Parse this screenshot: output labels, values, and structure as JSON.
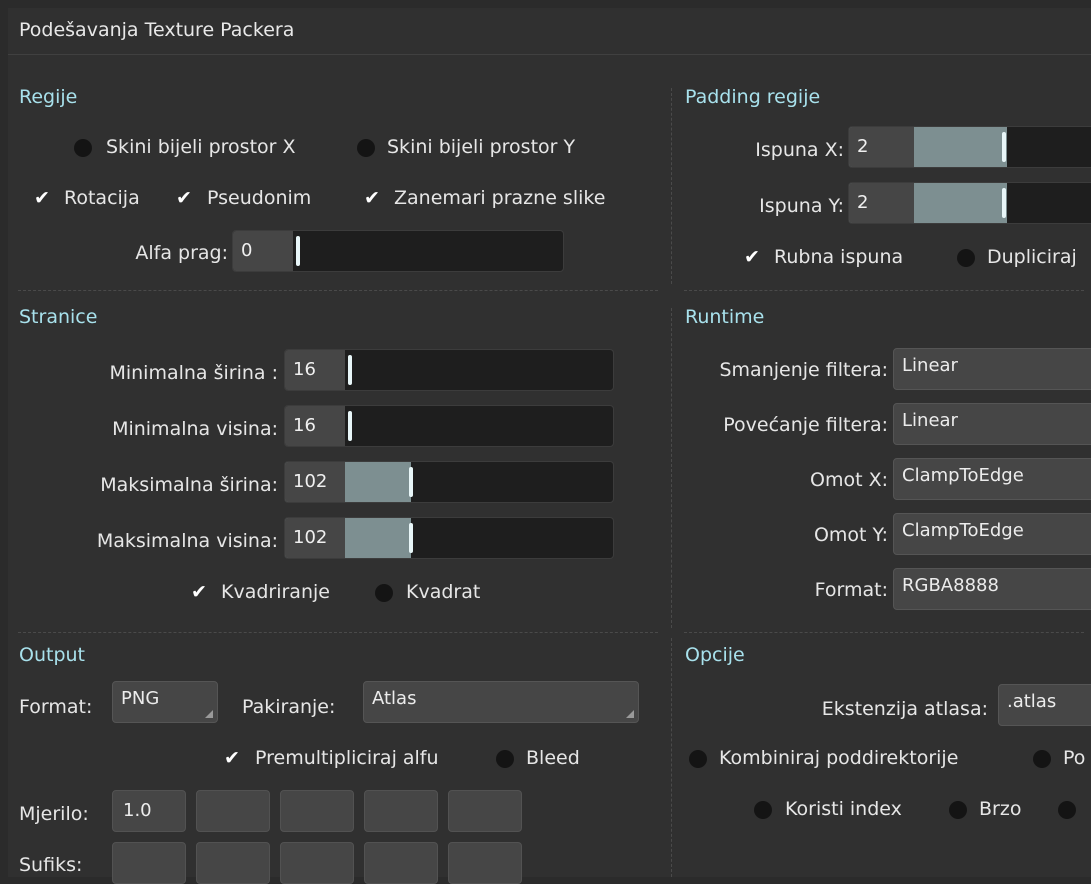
{
  "title": "Podešavanja Texture Packera",
  "regions": {
    "heading": "Regije",
    "strip_x": "Skini bijeli prostor X",
    "strip_y": "Skini bijeli prostor Y",
    "rotation": "Rotacija",
    "alias": "Pseudonim",
    "ignore_blank": "Zanemari prazne slike",
    "alpha_label": "Alfa prag:",
    "alpha_value": "0"
  },
  "padding": {
    "heading": "Padding regije",
    "pad_x_label": "Ispuna X:",
    "pad_x_value": "2",
    "pad_y_label": "Ispuna Y:",
    "pad_y_value": "2",
    "edge": "Rubna ispuna",
    "duplicate": "Dupliciraj"
  },
  "pages": {
    "heading": "Stranice",
    "min_w_label": "Minimalna širina :",
    "min_w_value": "16",
    "min_h_label": "Minimalna visina:",
    "min_h_value": "16",
    "max_w_label": "Maksimalna širina:",
    "max_w_value": "102",
    "max_h_label": "Maksimalna visina:",
    "max_h_value": "102",
    "pot": "Kvadriranje",
    "square": "Kvadrat"
  },
  "runtime": {
    "heading": "Runtime",
    "min_filter_label": "Smanjenje filtera:",
    "min_filter_value": "Linear",
    "mag_filter_label": "Povećanje filtera:",
    "mag_filter_value": "Linear",
    "wrap_x_label": "Omot X:",
    "wrap_x_value": "ClampToEdge",
    "wrap_y_label": "Omot Y:",
    "wrap_y_value": "ClampToEdge",
    "format_label": "Format:",
    "format_value": "RGBA8888"
  },
  "output": {
    "heading": "Output",
    "format_label": "Format:",
    "format_value": "PNG",
    "packing_label": "Pakiranje:",
    "packing_value": "Atlas",
    "premultiply": "Premultipliciraj alfu",
    "bleed": "Bleed",
    "scale_label": "Mjerilo:",
    "scale_value": "1.0",
    "suffix_label": "Sufiks:"
  },
  "options": {
    "heading": "Opcije",
    "ext_label": "Ekstenzija atlasa:",
    "ext_value": ".atlas",
    "combine": "Kombiniraj poddirektorije",
    "po_partial": "Po",
    "use_index": "Koristi index",
    "fast": "Brzo"
  }
}
